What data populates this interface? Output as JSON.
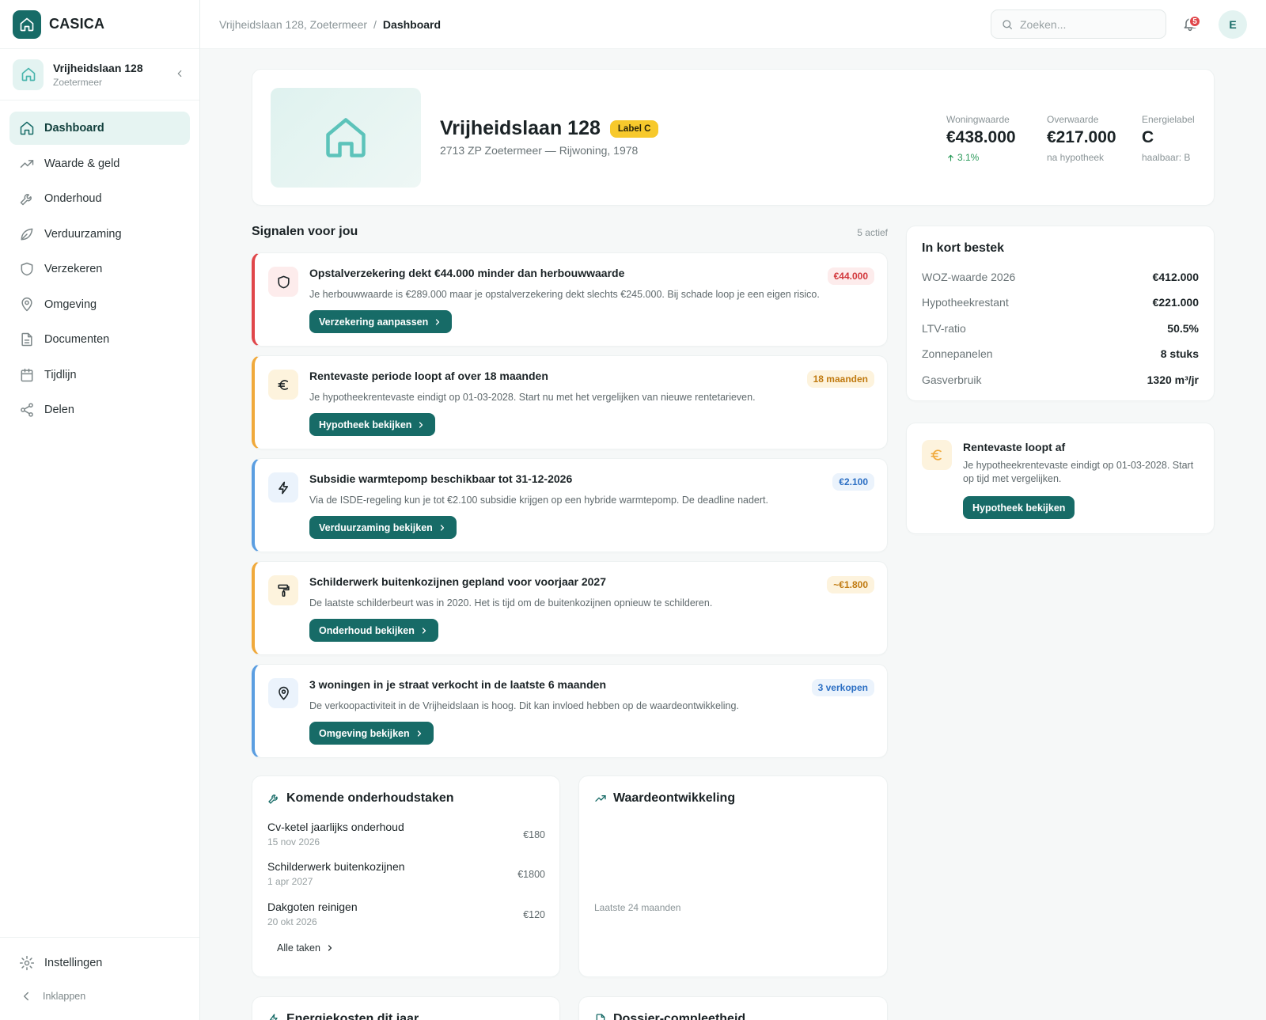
{
  "app": {
    "name": "CASICA",
    "colors": {
      "primary": "#176b67",
      "primary_light": "#e6f4f2",
      "label_c": "#f7c92c",
      "danger": "#e0464a",
      "warning": "#f0a93b",
      "info": "#5b9ee1"
    }
  },
  "property_switcher": {
    "name": "Vrijheidslaan 128",
    "city": "Zoetermeer"
  },
  "nav": {
    "items": [
      {
        "label": "Dashboard",
        "icon": "home-icon",
        "active": true
      },
      {
        "label": "Waarde & geld",
        "icon": "trending-up-icon"
      },
      {
        "label": "Onderhoud",
        "icon": "wrench-icon"
      },
      {
        "label": "Verduurzaming",
        "icon": "leaf-icon"
      },
      {
        "label": "Verzekeren",
        "icon": "shield-icon"
      },
      {
        "label": "Omgeving",
        "icon": "map-pin-icon"
      },
      {
        "label": "Documenten",
        "icon": "document-icon"
      },
      {
        "label": "Tijdlijn",
        "icon": "calendar-icon"
      },
      {
        "label": "Delen",
        "icon": "share-icon"
      }
    ],
    "settings_label": "Instellingen",
    "collapse_label": "Inklappen"
  },
  "topbar": {
    "breadcrumb": [
      "Vrijheidslaan 128, Zoetermeer",
      "Dashboard"
    ],
    "breadcrumb_sep": "/",
    "search_placeholder": "Zoeken...",
    "notification_count": "5",
    "avatar_initial": "E"
  },
  "hero": {
    "title": "Vrijheidslaan 128",
    "label_badge": "Label C",
    "subtitle": "2713 ZP Zoetermeer — Rijwoning, 1978",
    "stats": [
      {
        "label": "Woningwaarde",
        "value": "€438.000",
        "sub": "3.1%"
      },
      {
        "label": "Overwaarde",
        "value": "€217.000",
        "sub": "na hypotheek"
      },
      {
        "label": "Energielabel",
        "value": "C",
        "sub": "haalbaar: B"
      }
    ]
  },
  "signals": {
    "title": "Signalen voor jou",
    "count": "5 actief",
    "items": [
      {
        "title": "Opstalverzekering dekt €44.000 minder dan herbouwwaarde",
        "text": "Je herbouwwaarde is €289.000 maar je opstalverzekering dekt slechts €245.000. Bij schade loop je een eigen risico.",
        "badge": "€44.000",
        "button": "Verzekering aanpassen",
        "icon": "shield-icon",
        "severity": "danger"
      },
      {
        "title": "Rentevaste periode loopt af over 18 maanden",
        "text": "Je hypotheekrentevaste eindigt op 01-03-2028. Start nu met het vergelijken van nieuwe rentetarieven.",
        "badge": "18 maanden",
        "button": "Hypotheek bekijken",
        "icon": "euro-icon",
        "severity": "warning"
      },
      {
        "title": "Subsidie warmtepomp beschikbaar tot 31-12-2026",
        "text": "Via de ISDE-regeling kun je tot €2.100 subsidie krijgen op een hybride warmtepomp. De deadline nadert.",
        "badge": "€2.100",
        "button": "Verduurzaming bekijken",
        "icon": "lightning-icon",
        "severity": "info"
      },
      {
        "title": "Schilderwerk buitenkozijnen gepland voor voorjaar 2027",
        "text": "De laatste schilderbeurt was in 2020. Het is tijd om de buitenkozijnen opnieuw te schilderen.",
        "badge": "~€1.800",
        "button": "Onderhoud bekijken",
        "icon": "paint-roller-icon",
        "severity": "warning"
      },
      {
        "title": "3 woningen in je straat verkocht in de laatste 6 maanden",
        "text": "De verkoopactiviteit in de Vrijheidslaan is hoog. Dit kan invloed hebben op de waardeontwikkeling.",
        "badge": "3 verkopen",
        "button": "Omgeving bekijken",
        "icon": "map-pin-icon",
        "severity": "info"
      }
    ]
  },
  "summary": {
    "title": "In kort bestek",
    "rows": [
      {
        "key": "WOZ-waarde 2026",
        "value": "€412.000"
      },
      {
        "key": "Hypotheekrestant",
        "value": "€221.000"
      },
      {
        "key": "LTV-ratio",
        "value": "50.5%"
      },
      {
        "key": "Zonnepanelen",
        "value": "8 stuks"
      },
      {
        "key": "Gasverbruik",
        "value": "1320 m³/jr"
      }
    ]
  },
  "rente_card": {
    "title": "Rentevaste loopt af",
    "text": "Je hypotheekrentevaste eindigt op 01-03-2028. Start op tijd met vergelijken.",
    "button": "Hypotheek bekijken"
  },
  "maintenance": {
    "title": "Komende onderhoudstaken",
    "tasks": [
      {
        "name": "Cv-ketel jaarlijks onderhoud",
        "date": "15 nov 2026",
        "cost": "€180"
      },
      {
        "name": "Schilderwerk buitenkozijnen",
        "date": "1 apr 2027",
        "cost": "€1800"
      },
      {
        "name": "Dakgoten reinigen",
        "date": "20 okt 2026",
        "cost": "€120"
      }
    ],
    "all_link": "Alle taken"
  },
  "value_development": {
    "title": "Waardeontwikkeling",
    "note": "Laatste 24 maanden"
  },
  "peek_cards": {
    "energy_title": "Energiekosten dit jaar",
    "dossier_title": "Dossier-compleetheid"
  }
}
